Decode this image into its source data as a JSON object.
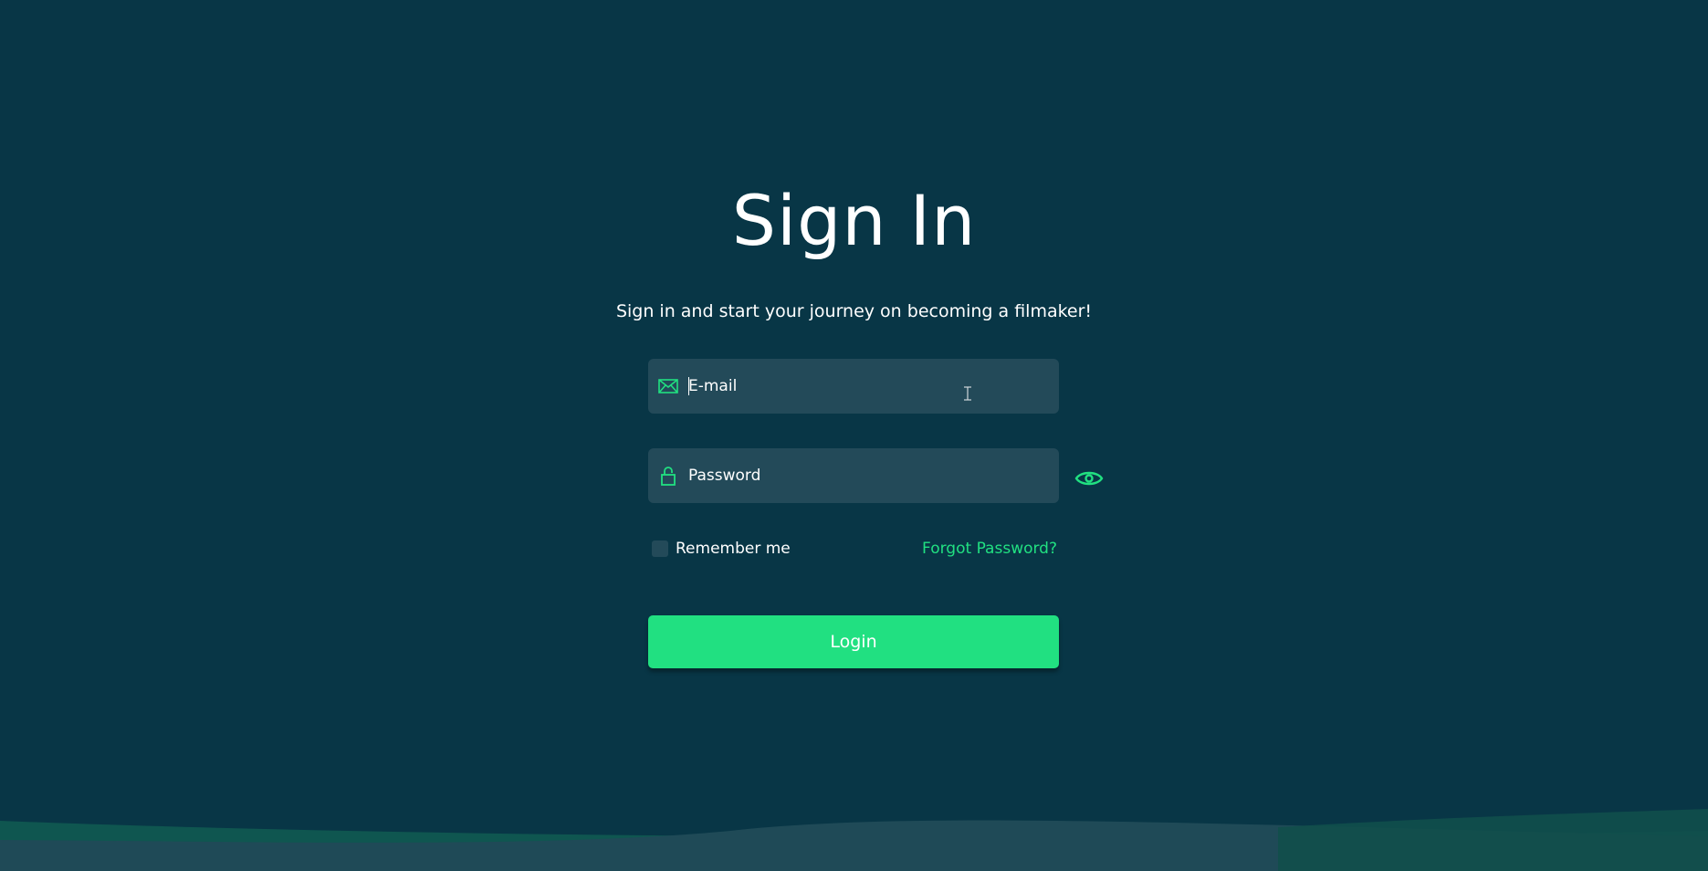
{
  "title": "Sign In",
  "subtitle": "Sign in and start your journey on becoming a filmaker!",
  "email": {
    "placeholder": "E-mail",
    "value": "",
    "icon": "envelope-icon"
  },
  "password": {
    "placeholder": "Password",
    "value": "",
    "icon": "lock-icon",
    "toggle_icon": "eye-icon"
  },
  "remember_me": {
    "label": "Remember me",
    "checked": false
  },
  "forgot_password_label": "Forgot Password?",
  "login_label": "Login",
  "colors": {
    "background": "#083646",
    "field": "#234a59",
    "accent": "#21e081",
    "text": "#ffffff"
  }
}
